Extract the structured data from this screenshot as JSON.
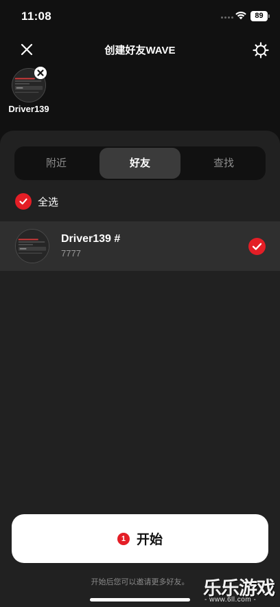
{
  "status": {
    "time": "11:08",
    "battery": "89"
  },
  "nav": {
    "title": "创建好友WAVE",
    "icons": {
      "close": "close-icon",
      "settings": "gear-icon"
    }
  },
  "selected": [
    {
      "name": "Driver139"
    }
  ],
  "tabs": [
    {
      "label": "附近",
      "active": false
    },
    {
      "label": "好友",
      "active": true
    },
    {
      "label": "查找",
      "active": false
    }
  ],
  "select_all": {
    "label": "全选",
    "checked": true
  },
  "friends": [
    {
      "name": "Driver139 #",
      "id": "7777",
      "checked": true
    }
  ],
  "start": {
    "count": "1",
    "label": "开始"
  },
  "hint": "开始后您可以邀请更多好友。",
  "watermark": {
    "text": "乐乐游戏",
    "url": "- www.6ll.com -"
  },
  "colors": {
    "accent": "#e41e26",
    "background": "#111111",
    "sheet": "#212121",
    "row": "#2f2f2f"
  }
}
